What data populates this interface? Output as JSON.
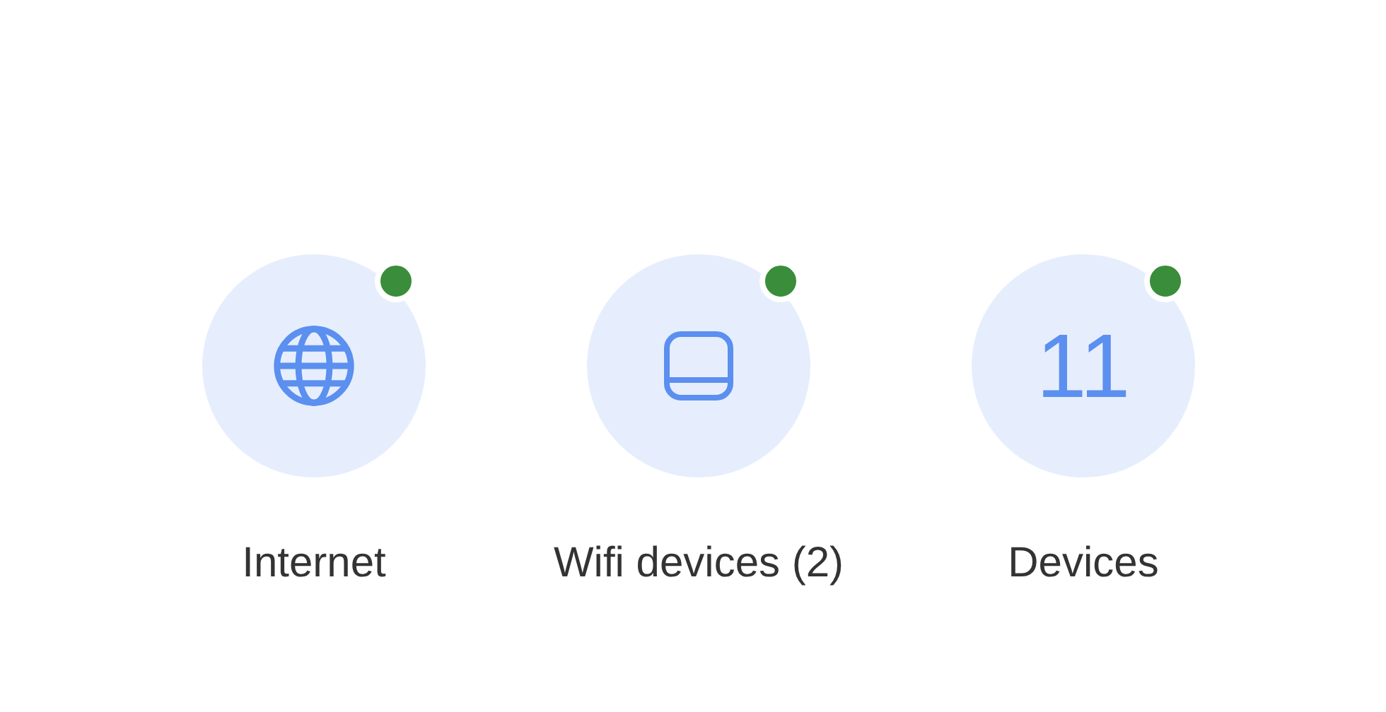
{
  "items": [
    {
      "kind": "globe",
      "label": "Internet",
      "color": "#3a8d3a"
    },
    {
      "kind": "router",
      "label": "Wifi devices (2)",
      "color": "#3a8d3a"
    },
    {
      "kind": "count",
      "count": "11",
      "label": "Devices",
      "color": "#3a8d3a"
    }
  ]
}
